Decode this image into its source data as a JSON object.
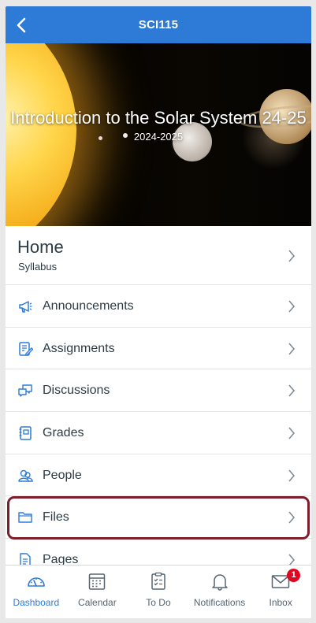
{
  "header": {
    "title": "SCI115",
    "back_icon": "chevron-left-icon",
    "background": "#2d7bd6"
  },
  "hero": {
    "title": "Introduction to the Solar System 24-25",
    "term": "2024-2025"
  },
  "home": {
    "title": "Home",
    "subtitle": "Syllabus"
  },
  "menu": [
    {
      "label": "Announcements",
      "icon": "megaphone-icon"
    },
    {
      "label": "Assignments",
      "icon": "assignment-icon"
    },
    {
      "label": "Discussions",
      "icon": "discussion-icon"
    },
    {
      "label": "Grades",
      "icon": "gradebook-icon"
    },
    {
      "label": "People",
      "icon": "people-icon"
    },
    {
      "label": "Files",
      "icon": "folder-icon",
      "highlighted": true
    },
    {
      "label": "Pages",
      "icon": "document-icon"
    }
  ],
  "tabbar": {
    "tabs": [
      {
        "label": "Dashboard",
        "icon": "dashboard-icon",
        "active": true
      },
      {
        "label": "Calendar",
        "icon": "calendar-icon"
      },
      {
        "label": "To Do",
        "icon": "todo-icon"
      },
      {
        "label": "Notifications",
        "icon": "bell-icon"
      },
      {
        "label": "Inbox",
        "icon": "mail-icon",
        "badge": "1"
      }
    ],
    "active_color": "#2d7bd6",
    "badge_color": "#e0061f"
  },
  "highlight_color": "#7a1f2b"
}
